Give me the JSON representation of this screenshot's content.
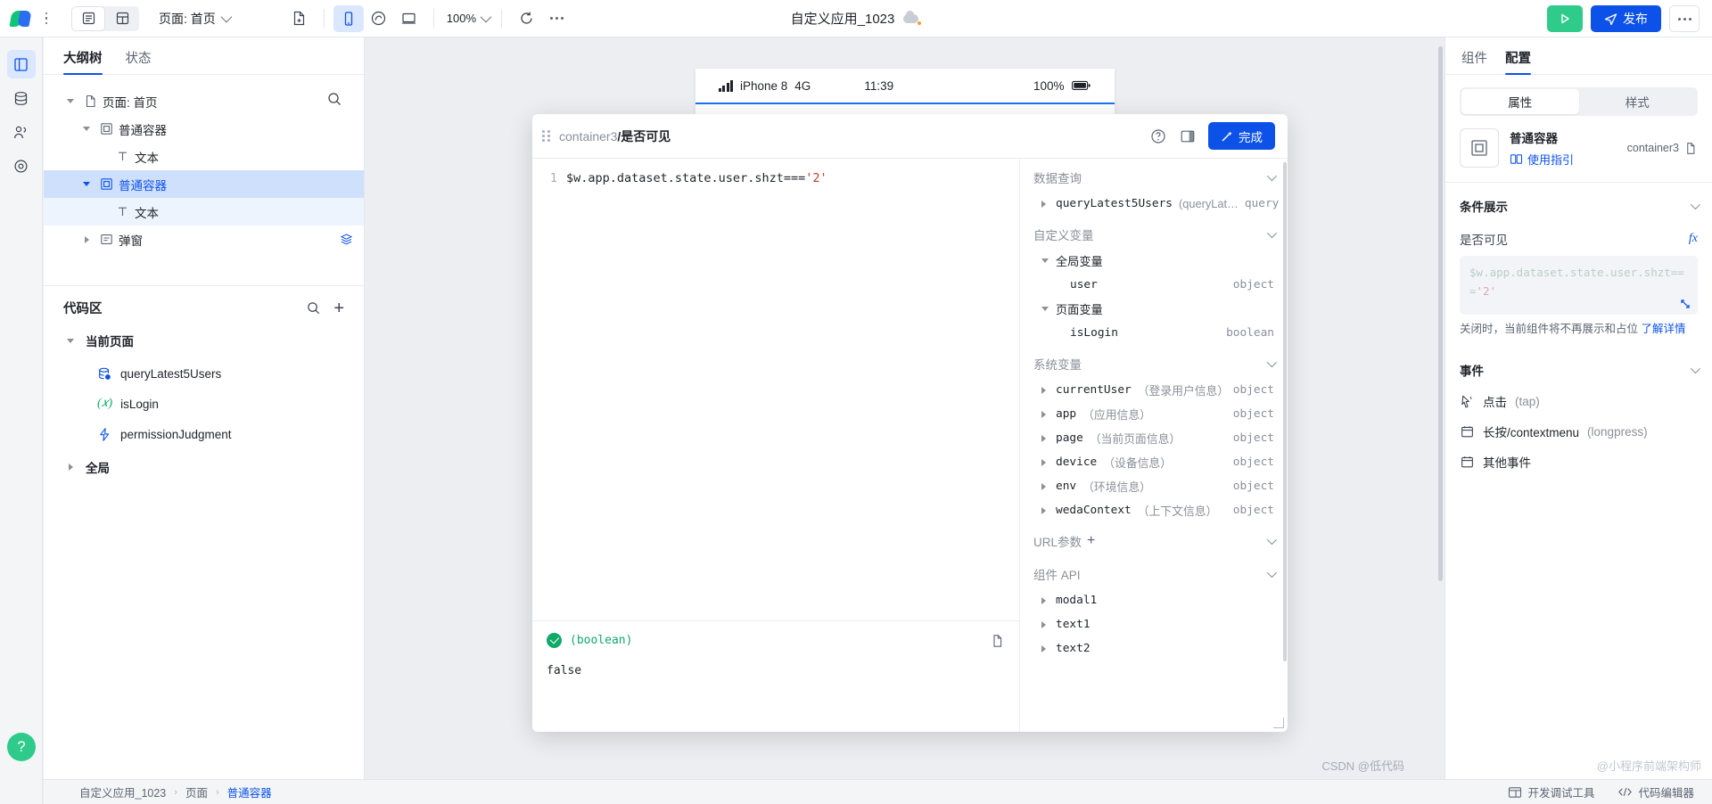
{
  "topbar": {
    "logo_name": "weda-logo",
    "view_toggle": [
      {
        "name": "outline-view",
        "icon": "list-panel-icon"
      },
      {
        "name": "grid-view",
        "icon": "layout-grid-icon"
      }
    ],
    "page_selector": "页面: 首页",
    "new_page_icon": "file-plus-icon",
    "device_buttons": [
      {
        "name": "mobile-preview",
        "icon": "phone-icon",
        "selected": true
      },
      {
        "name": "mini-program-preview",
        "icon": "wechat-miniapp-icon",
        "selected": false
      },
      {
        "name": "desktop-preview",
        "icon": "monitor-icon",
        "selected": false
      }
    ],
    "zoom_level": "100%",
    "refresh_icon": "refresh-icon",
    "more_icon": "ellipsis-icon",
    "app_title": "自定义应用_1023",
    "cloud_status_icon": "cloud-sync-icon",
    "run_label": "run",
    "publish_label": "发布",
    "more_label": "more"
  },
  "rail": {
    "items": [
      {
        "name": "rail-item-pages",
        "icon": "pages-icon",
        "active": true
      },
      {
        "name": "rail-item-data",
        "icon": "database-icon",
        "active": false
      },
      {
        "name": "rail-item-users",
        "icon": "users-icon",
        "active": false
      },
      {
        "name": "rail-item-settings",
        "icon": "target-icon",
        "active": false
      }
    ],
    "help_label": "?"
  },
  "left_panel": {
    "tabs": [
      {
        "label": "大纲树",
        "active": true
      },
      {
        "label": "状态",
        "active": false
      }
    ],
    "search_icon": "search-icon",
    "tree": [
      {
        "label": "页面: 首页",
        "icon": "page-icon",
        "depth": 0,
        "expanded": true,
        "selected": false
      },
      {
        "label": "普通容器",
        "icon": "container-icon",
        "depth": 1,
        "expanded": true,
        "selected": false
      },
      {
        "label": "文本",
        "icon": "text-icon",
        "depth": 2,
        "expanded": null,
        "selected": false
      },
      {
        "label": "普通容器",
        "icon": "container-icon",
        "depth": 1,
        "expanded": true,
        "selected": true
      },
      {
        "label": "文本",
        "icon": "text-icon",
        "depth": 2,
        "expanded": null,
        "selected": false,
        "childSel": true
      },
      {
        "label": "弹窗",
        "icon": "modal-icon",
        "depth": 1,
        "expanded": false,
        "selected": false,
        "trailing": "stack-icon"
      }
    ],
    "code_area": {
      "title": "代码区",
      "search_icon": "search-icon",
      "add_icon": "plus-icon",
      "groups": [
        {
          "label": "当前页面",
          "expanded": true,
          "items": [
            {
              "label": "queryLatest5Users",
              "icon": "dataset-icon"
            },
            {
              "label": "isLogin",
              "icon": "variable-icon"
            },
            {
              "label": "permissionJudgment",
              "icon": "function-icon"
            }
          ]
        },
        {
          "label": "全局",
          "expanded": false,
          "items": []
        }
      ]
    }
  },
  "canvas": {
    "phone_status": {
      "signal_icon": "signal-bars-icon",
      "carrier": "iPhone 8",
      "network": "4G",
      "time": "11:39",
      "battery_pct": "100%",
      "battery_icon": "battery-full-icon"
    }
  },
  "modal": {
    "grip_icon": "drag-grip-icon",
    "breadcrumb_path": "container3",
    "breadcrumb_sep": "/",
    "breadcrumb_field": "是否可见",
    "help_icon": "help-circle-icon",
    "layout_icon": "panel-right-icon",
    "done_icon": "magic-wand-icon",
    "done_label": "完成",
    "editor": {
      "line_number": "1",
      "code_prefix": "$w.app.dataset.state.user.shzt===",
      "code_string": "'2'"
    },
    "result": {
      "status_icon": "check-circle-icon",
      "type_label": "(boolean)",
      "copy_icon": "copy-icon",
      "value": "false"
    },
    "variables": [
      {
        "kind": "section",
        "label": "数据查询",
        "collapsible": true
      },
      {
        "kind": "row",
        "label": "queryLatest5Users",
        "note": "(queryLat…",
        "type": "query",
        "arrow": "right",
        "indent": 1,
        "mono": true
      },
      {
        "kind": "section",
        "label": "自定义变量",
        "collapsible": true
      },
      {
        "kind": "group",
        "label": "全局变量",
        "arrow": "down",
        "indent": 1
      },
      {
        "kind": "row",
        "label": "user",
        "note": "",
        "type": "object",
        "arrow": "none",
        "indent": 2,
        "mono": true
      },
      {
        "kind": "group",
        "label": "页面变量",
        "arrow": "down",
        "indent": 1
      },
      {
        "kind": "row",
        "label": "isLogin",
        "note": "",
        "type": "boolean",
        "arrow": "none",
        "indent": 2,
        "mono": true
      },
      {
        "kind": "section",
        "label": "系统变量",
        "collapsible": true
      },
      {
        "kind": "row",
        "label": "currentUser",
        "note": "（登录用户信息）",
        "type": "object",
        "arrow": "right",
        "indent": 1,
        "mono": true
      },
      {
        "kind": "row",
        "label": "app",
        "note": "（应用信息）",
        "type": "object",
        "arrow": "right",
        "indent": 1,
        "mono": true
      },
      {
        "kind": "row",
        "label": "page",
        "note": "（当前页面信息）",
        "type": "object",
        "arrow": "right",
        "indent": 1,
        "mono": true
      },
      {
        "kind": "row",
        "label": "device",
        "note": "（设备信息）",
        "type": "object",
        "arrow": "right",
        "indent": 1,
        "mono": true
      },
      {
        "kind": "row",
        "label": "env",
        "note": "（环境信息）",
        "type": "object",
        "arrow": "right",
        "indent": 1,
        "mono": true
      },
      {
        "kind": "row",
        "label": "wedaContext",
        "note": "（上下文信息）",
        "type": "object",
        "arrow": "right",
        "indent": 1,
        "mono": true
      },
      {
        "kind": "section",
        "label": "URL参数",
        "collapsible": true,
        "plus": "+"
      },
      {
        "kind": "section",
        "label": "组件 API",
        "collapsible": true
      },
      {
        "kind": "row",
        "label": "modal1",
        "note": "",
        "type": "",
        "arrow": "right",
        "indent": 1,
        "mono": true
      },
      {
        "kind": "row",
        "label": "text1",
        "note": "",
        "type": "",
        "arrow": "right",
        "indent": 1,
        "mono": true
      },
      {
        "kind": "row",
        "label": "text2",
        "note": "",
        "type": "",
        "arrow": "right",
        "indent": 1,
        "mono": true
      }
    ]
  },
  "right_panel": {
    "tabs": [
      {
        "label": "组件",
        "active": false
      },
      {
        "label": "配置",
        "active": true
      }
    ],
    "segment": [
      {
        "label": "属性",
        "active": true
      },
      {
        "label": "样式",
        "active": false
      }
    ],
    "component": {
      "thumb_icon": "container-icon",
      "name": "普通容器",
      "guide_icon": "book-icon",
      "guide_label": "使用指引",
      "id": "container3",
      "copy_icon": "copy-icon"
    },
    "condition_section": {
      "title": "条件展示",
      "field_label": "是否可见",
      "fx_label": "fx",
      "expression_prefix": "$w.app.dataset.state.user.",
      "expression_mid": "shzt===",
      "expression_string": "'2'",
      "expand_icon": "expand-icon",
      "hint_text": "关闭时，当前组件将不再展示和占位 ",
      "hint_link": "了解详情"
    },
    "events_section": {
      "title": "事件",
      "items": [
        {
          "icon": "cursor-click-icon",
          "label": "点击 ",
          "mut": "(tap)"
        },
        {
          "icon": "calendar-icon",
          "label": "长按/contextmenu ",
          "mut": "(longpress)"
        },
        {
          "icon": "calendar-icon",
          "label": "其他事件",
          "mut": ""
        }
      ]
    }
  },
  "status_bar": {
    "breadcrumb": [
      {
        "label": "自定义应用_1023",
        "active": false
      },
      {
        "label": "页面",
        "active": false
      },
      {
        "label": "普通容器",
        "active": true
      }
    ],
    "separator": "›",
    "buttons": [
      {
        "icon": "devtools-icon",
        "label": "开发调试工具"
      },
      {
        "icon": "code-icon",
        "label": "代码编辑器"
      }
    ]
  },
  "watermark": {
    "left": "CSDN @低代码",
    "right": "@小程序前端架构师"
  },
  "colors": {
    "accent": "#0d52e8",
    "success": "#2ecb8b",
    "selection": "#cfe0fd",
    "panel_bg": "#ffffff",
    "canvas_bg": "#eceef1"
  }
}
